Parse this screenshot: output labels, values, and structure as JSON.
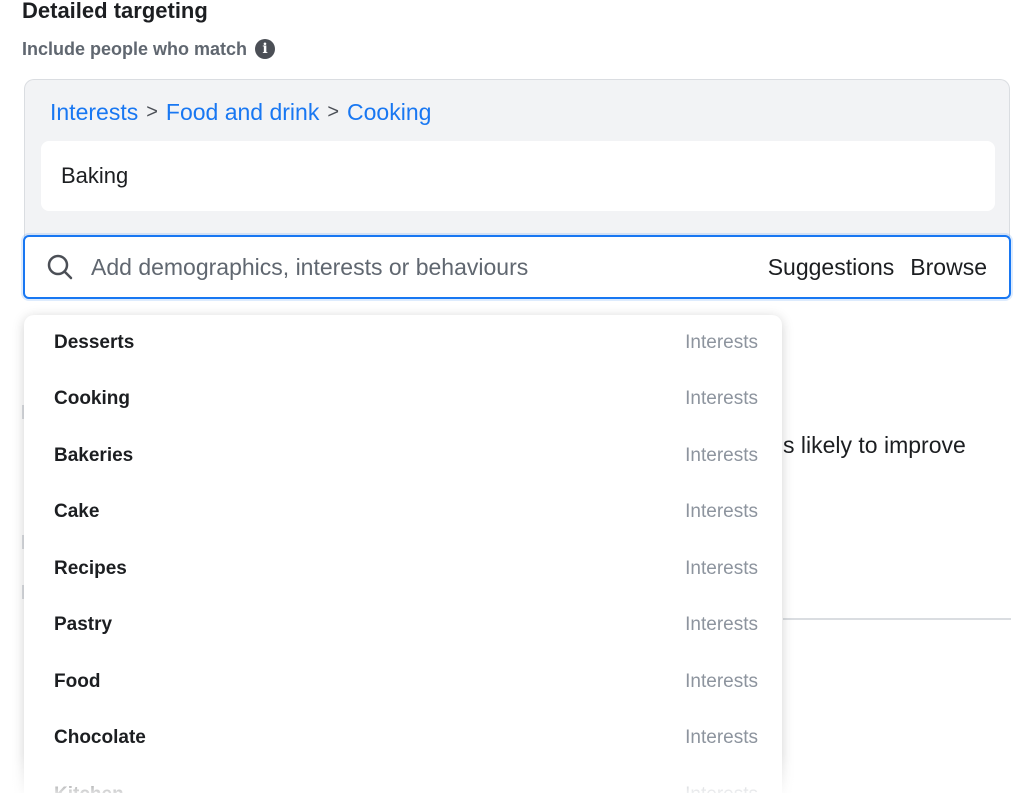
{
  "section": {
    "title": "Detailed targeting",
    "subtitle": "Include people who match"
  },
  "breadcrumb": {
    "items": [
      "Interests",
      "Food and drink",
      "Cooking"
    ],
    "separator": ">"
  },
  "selected": {
    "item": "Baking"
  },
  "search": {
    "placeholder": "Add demographics, interests or behaviours",
    "suggestions_label": "Suggestions",
    "browse_label": "Browse"
  },
  "background": {
    "partial_text": "s likely to improve"
  },
  "dropdown": {
    "items": [
      {
        "name": "Desserts",
        "type": "Interests"
      },
      {
        "name": "Cooking",
        "type": "Interests"
      },
      {
        "name": "Bakeries",
        "type": "Interests"
      },
      {
        "name": "Cake",
        "type": "Interests"
      },
      {
        "name": "Recipes",
        "type": "Interests"
      },
      {
        "name": "Pastry",
        "type": "Interests"
      },
      {
        "name": "Food",
        "type": "Interests"
      },
      {
        "name": "Chocolate",
        "type": "Interests"
      },
      {
        "name": "Kitchen",
        "type": "Interests"
      }
    ]
  },
  "colors": {
    "accent": "#1877f2",
    "panel_bg": "#f2f3f5",
    "muted_text": "#8d949e"
  },
  "icons": {
    "info": "info-icon",
    "search": "search-icon"
  }
}
